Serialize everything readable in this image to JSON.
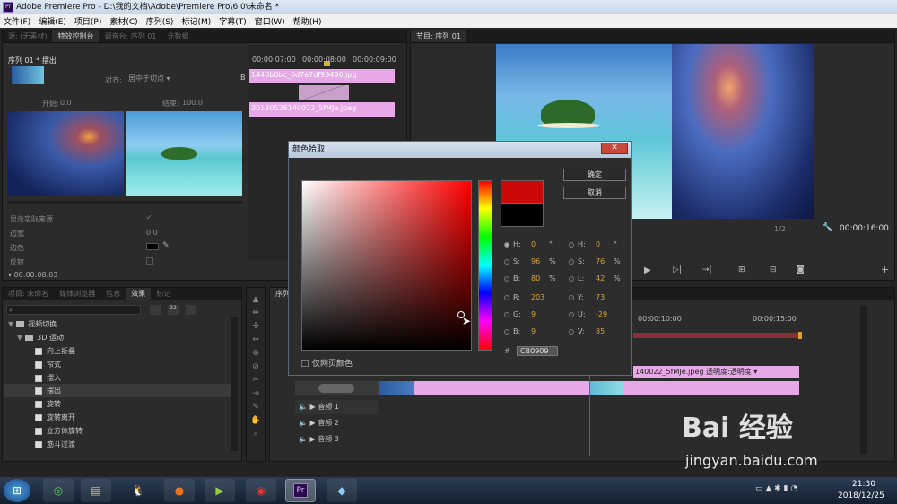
{
  "window": {
    "title": "Adobe Premiere Pro - D:\\我的文档\\Adobe\\Premiere Pro\\6.0\\未命名 *",
    "app_icon": "Pr"
  },
  "menu": [
    "文件(F)",
    "编辑(E)",
    "项目(P)",
    "素材(C)",
    "序列(S)",
    "标记(M)",
    "字幕(T)",
    "窗口(W)",
    "帮助(H)"
  ],
  "top_left_tabs": [
    "源: (无素材)",
    "特效控制台",
    "调音台: 序列 01",
    "元数据"
  ],
  "effect_controls": {
    "sequence": "序列 01 * 摆出",
    "align_label": "对齐:",
    "align_value": "居中于切点",
    "start_label": "开始:",
    "start_value": "0.0",
    "end_label": "结束:",
    "end_value": "100.0",
    "show_actual": "显示实际来源",
    "border_width": "边宽",
    "border_width_value": "0.0",
    "border_color": "边色",
    "reverse": "反转",
    "timecode": "00:00:08:03",
    "ruler": [
      "00:00:07:00",
      "00:00:08:00",
      "00:00:09:00"
    ],
    "clip_a": "1440b0bc_0d7e7df93496.jpg",
    "clip_b": "20130526140022_5fMJe.jpeg",
    "track_marker": "B"
  },
  "program": {
    "tab": "节目: 序列 01",
    "timecode": "00:00:16:00",
    "fraction": "1/2"
  },
  "bottom_left_tabs": [
    "项目: 未命名",
    "媒体浏览器",
    "信息",
    "效果",
    "标记"
  ],
  "effects_tree": {
    "folder": "视频切换",
    "subfolder": "3D 运动",
    "items": [
      "向上折叠",
      "帘式",
      "摆入",
      "摆出",
      "旋转",
      "旋转离开",
      "立方体旋转",
      "筋斗过渡"
    ],
    "selected": "摆出"
  },
  "timeline": {
    "tab": "序列",
    "ruler": [
      "00:00:10:00",
      "00:00:15:00"
    ],
    "clip_label": "140022_5fMJe.jpeg",
    "opacity_label": "透明度:透明度",
    "audio_tracks": [
      "音频 1",
      "音频 2",
      "音频 3"
    ]
  },
  "color_picker": {
    "title": "颜色拾取",
    "ok": "确定",
    "cancel": "取消",
    "params": [
      {
        "name": "H:",
        "value": "0",
        "unit": "°"
      },
      {
        "name": "S:",
        "value": "96",
        "unit": "%"
      },
      {
        "name": "B:",
        "value": "80",
        "unit": "%"
      },
      {
        "name": "R:",
        "value": "203",
        "unit": ""
      },
      {
        "name": "G:",
        "value": "9",
        "unit": ""
      },
      {
        "name": "B:",
        "value": "9",
        "unit": ""
      }
    ],
    "params2": [
      {
        "name": "H:",
        "value": "0",
        "unit": "°"
      },
      {
        "name": "S:",
        "value": "76",
        "unit": "%"
      },
      {
        "name": "L:",
        "value": "42",
        "unit": "%"
      },
      {
        "name": "Y:",
        "value": "73",
        "unit": ""
      },
      {
        "name": "U:",
        "value": "-29",
        "unit": ""
      },
      {
        "name": "V:",
        "value": "85",
        "unit": ""
      }
    ],
    "hex_label": "#",
    "hex": "CB0909",
    "web_only": "仅网页颜色",
    "new_color": "#cb0909",
    "old_color": "#000000"
  },
  "taskbar": {
    "time": "21:30",
    "date": "2018/12/25"
  },
  "watermark": {
    "brand": "Bai 经验",
    "url": "jingyan.baidu.com"
  }
}
